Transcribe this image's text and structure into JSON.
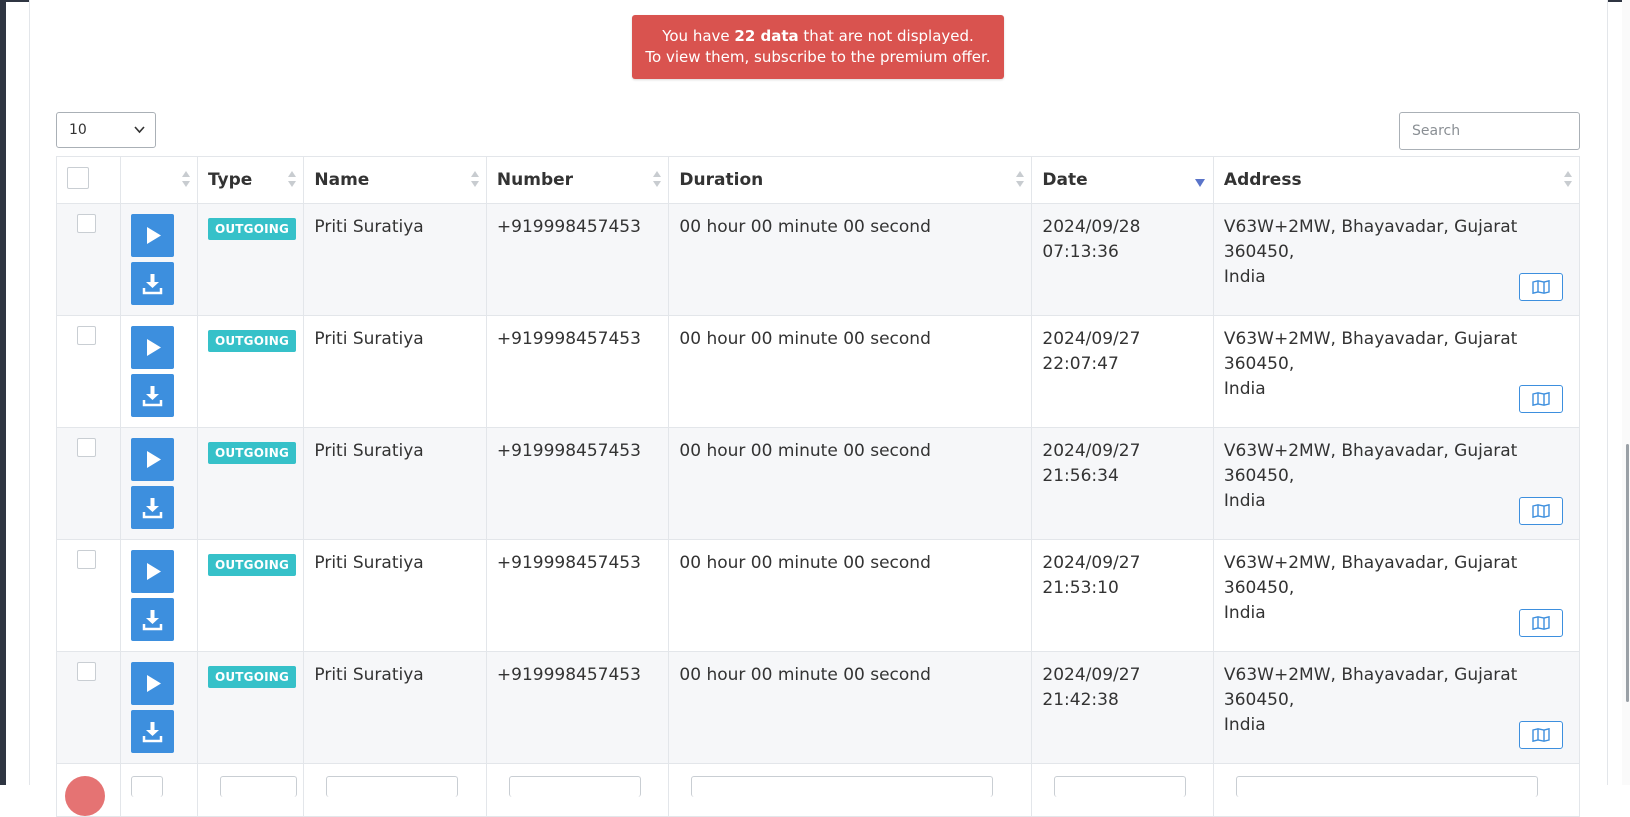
{
  "alert": {
    "pre": "You have ",
    "count": "22 data",
    "post": " that are not displayed.",
    "line2": "To view them, subscribe to the premium offer."
  },
  "length_select": {
    "value": "10"
  },
  "search": {
    "placeholder": "Search"
  },
  "table": {
    "headers": [
      "Type",
      "Name",
      "Number",
      "Duration",
      "Date",
      "Address"
    ],
    "sorted_column": "Date",
    "rows": [
      {
        "type": "OUTGOING",
        "name": "Priti Suratiya",
        "number": "+919998457453",
        "duration": "00 hour 00 minute 00 second",
        "date": "2024/09/28",
        "time": "07:13:36",
        "address_l1": "V63W+2MW, Bhayavadar, Gujarat 360450,",
        "address_l2": "India"
      },
      {
        "type": "OUTGOING",
        "name": "Priti Suratiya",
        "number": "+919998457453",
        "duration": "00 hour 00 minute 00 second",
        "date": "2024/09/27",
        "time": "22:07:47",
        "address_l1": "V63W+2MW, Bhayavadar, Gujarat 360450,",
        "address_l2": "India"
      },
      {
        "type": "OUTGOING",
        "name": "Priti Suratiya",
        "number": "+919998457453",
        "duration": "00 hour 00 minute 00 second",
        "date": "2024/09/27",
        "time": "21:56:34",
        "address_l1": "V63W+2MW, Bhayavadar, Gujarat 360450,",
        "address_l2": "India"
      },
      {
        "type": "OUTGOING",
        "name": "Priti Suratiya",
        "number": "+919998457453",
        "duration": "00 hour 00 minute 00 second",
        "date": "2024/09/27",
        "time": "21:53:10",
        "address_l1": "V63W+2MW, Bhayavadar, Gujarat 360450,",
        "address_l2": "India"
      },
      {
        "type": "OUTGOING",
        "name": "Priti Suratiya",
        "number": "+919998457453",
        "duration": "00 hour 00 minute 00 second",
        "date": "2024/09/27",
        "time": "21:42:38",
        "address_l1": "V63W+2MW, Bhayavadar, Gujarat 360450,",
        "address_l2": "India"
      }
    ]
  },
  "icons": {
    "play": "play-icon",
    "download": "download-icon",
    "map": "map-icon",
    "sort": "sort-icon"
  },
  "colors": {
    "alert_bg": "#d9534f",
    "primary_button": "#3d8fde",
    "badge_outgoing": "#36c1c9",
    "sort_active": "#5a74c9"
  }
}
